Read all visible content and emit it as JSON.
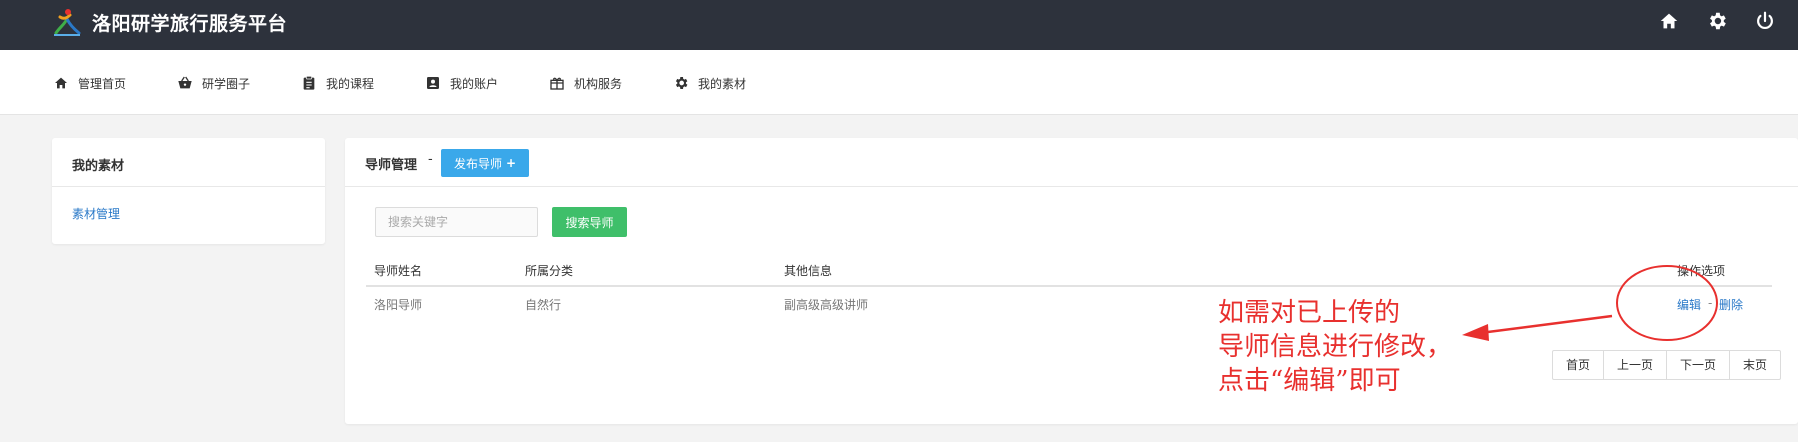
{
  "header": {
    "brand": "洛阳研学旅行服务平台",
    "icons": [
      "home-icon",
      "gear-icon",
      "power-icon"
    ],
    "bg_color": "#2d323c"
  },
  "nav": {
    "items": [
      {
        "label": "管理首页",
        "icon": "home-icon"
      },
      {
        "label": "研学圈子",
        "icon": "basket-icon"
      },
      {
        "label": "我的课程",
        "icon": "clipboard-icon"
      },
      {
        "label": "我的账户",
        "icon": "account-icon"
      },
      {
        "label": "机构服务",
        "icon": "gift-icon"
      },
      {
        "label": "我的素材",
        "icon": "gear-icon"
      }
    ]
  },
  "sidebar": {
    "title": "我的素材",
    "items": [
      {
        "label": "素材管理"
      }
    ]
  },
  "main": {
    "title": "导师管理",
    "separator": "-",
    "publish_button": "发布导师",
    "publish_plus": "+",
    "search": {
      "placeholder": "搜索关键字",
      "button": "搜索导师"
    },
    "table": {
      "columns": [
        "导师姓名",
        "所属分类",
        "其他信息",
        "操作选项"
      ],
      "rows": [
        {
          "name": "洛阳导师",
          "category": "自然行",
          "info": "副高级高级讲师",
          "edit": "编辑",
          "sep": "-",
          "delete": "删除"
        }
      ]
    },
    "pager": [
      "首页",
      "上一页",
      "下一页",
      "末页"
    ]
  },
  "annotation": {
    "lines": [
      "如需对已上传的",
      "导师信息进行修改，",
      "点击“编辑”即可"
    ],
    "color": "#e8302e"
  },
  "colors": {
    "link": "#2a79c8",
    "publish_button": "#3aa8ea",
    "search_button": "#3fbf6a"
  }
}
